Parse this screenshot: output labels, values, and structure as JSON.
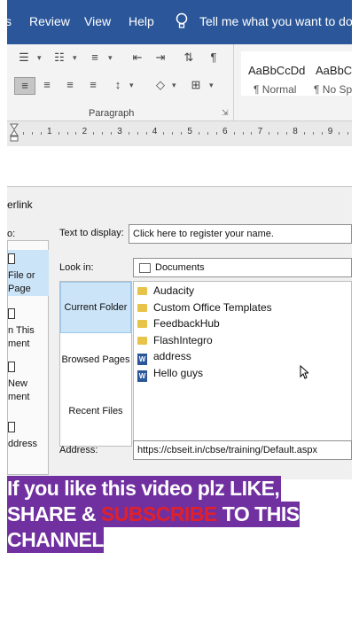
{
  "ribbon": {
    "tabs": [
      "s",
      "Review",
      "View",
      "Help"
    ],
    "tell_me": "Tell me what you want to do",
    "group_label": "Paragraph",
    "styles": [
      {
        "sample": "AaBbCcDd",
        "name": "¶ Normal"
      },
      {
        "sample": "AaBbC",
        "name": "¶ No Sp"
      }
    ]
  },
  "ruler": {
    "numbers": [
      "1",
      "2",
      "3",
      "4",
      "5",
      "6",
      "7",
      "8",
      "9"
    ]
  },
  "dialog": {
    "title": "erlink",
    "link_to_label": "o:",
    "link_options": [
      {
        "lines": [
          "File or",
          "Page"
        ]
      },
      {
        "lines": [
          "n This",
          "ment"
        ]
      },
      {
        "lines": [
          "New",
          "ment"
        ]
      },
      {
        "lines": [
          "ddress"
        ]
      }
    ],
    "text_to_display_label": "Text to display:",
    "text_to_display_value": "Click here to register your name.",
    "look_in_label": "Look in:",
    "look_in_value": "Documents",
    "nav": {
      "current_folder": "Current Folder",
      "browsed_pages": "Browsed Pages",
      "recent_files": "Recent Files"
    },
    "files": [
      {
        "name": "Audacity",
        "type": "folder"
      },
      {
        "name": "Custom Office Templates",
        "type": "folder"
      },
      {
        "name": "FeedbackHub",
        "type": "folder"
      },
      {
        "name": "FlashIntegro",
        "type": "folder"
      },
      {
        "name": "address",
        "type": "word"
      },
      {
        "name": "Hello guys",
        "type": "word"
      }
    ],
    "address_label": "Address:",
    "address_value": "https://cbseit.in/cbse/training/Default.aspx"
  },
  "caption": {
    "line1": "If you like this video plz LIKE,",
    "line2_a": "SHARE & ",
    "line2_b": "SUBSCRIBE",
    "line2_c": " TO THIS",
    "line3": "CHANNEL"
  },
  "colors": {
    "ribbon_blue": "#2b579a",
    "caption_bg": "#7030a0",
    "caption_red": "#e0202a",
    "selected_nav": "#cce4f7"
  }
}
